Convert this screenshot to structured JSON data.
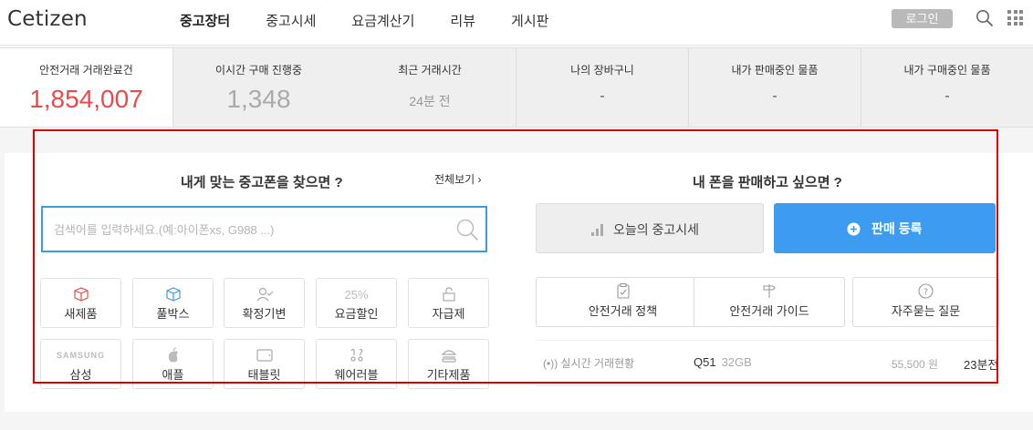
{
  "header": {
    "logo": "Cetizen",
    "nav": [
      "중고장터",
      "중고시세",
      "요금계산기",
      "리뷰",
      "게시판"
    ],
    "login_label": "로그인"
  },
  "stats": {
    "safe_trades": {
      "label": "안전거래 거래완료건",
      "value": "1,854,007"
    },
    "buying_now": {
      "label": "이시간 구매 진행중",
      "value": "1,348"
    },
    "recent_trade": {
      "label": "최근 거래시간",
      "value": "24분 전"
    },
    "my_cart": {
      "label": "나의 장바구니",
      "value": "-"
    },
    "my_selling": {
      "label": "내가 판매중인 물품",
      "value": "-"
    },
    "my_buying": {
      "label": "내가 구매중인 물품",
      "value": "-"
    }
  },
  "find": {
    "title": "내게 맞는 중고폰을 찾으면 ?",
    "view_all": "전체보기",
    "search_placeholder": "검색어를 입력하세요.(예:아이폰xs, G988 ...)",
    "categories_row1": [
      {
        "label": "새제품",
        "icon": "box-red-icon"
      },
      {
        "label": "풀박스",
        "icon": "box-blue-icon"
      },
      {
        "label": "확정기변",
        "icon": "user-check-icon"
      },
      {
        "label": "요금할인",
        "icon": "percent-icon",
        "badge": "25%"
      },
      {
        "label": "자급제",
        "icon": "unlock-icon"
      }
    ],
    "categories_row2": [
      {
        "label": "삼성",
        "icon": "samsung-logo",
        "brand": "SAMSUNG"
      },
      {
        "label": "애플",
        "icon": "apple-icon"
      },
      {
        "label": "태블릿",
        "icon": "tablet-icon"
      },
      {
        "label": "웨어러블",
        "icon": "watch-icon"
      },
      {
        "label": "기타제품",
        "icon": "burger-icon"
      }
    ]
  },
  "sell": {
    "title": "내 폰을 판매하고 싶으면 ?",
    "market_label": "오늘의 중고시세",
    "register_label": "판매 등록",
    "info_buttons": [
      {
        "label": "안전거래 정책",
        "icon": "clipboard-icon"
      },
      {
        "label": "안전거래 가이드",
        "icon": "signpost-icon"
      },
      {
        "label": "자주묻는 질문",
        "icon": "question-icon"
      }
    ]
  },
  "realtime": {
    "label": "실시간 거래현황",
    "model": "Q51",
    "storage": "32GB",
    "price": "55,500 원",
    "time": "23분전"
  },
  "colors": {
    "accent_blue": "#3d9cf0",
    "highlight_red": "#e00000",
    "stat_red": "#e94a4a"
  }
}
